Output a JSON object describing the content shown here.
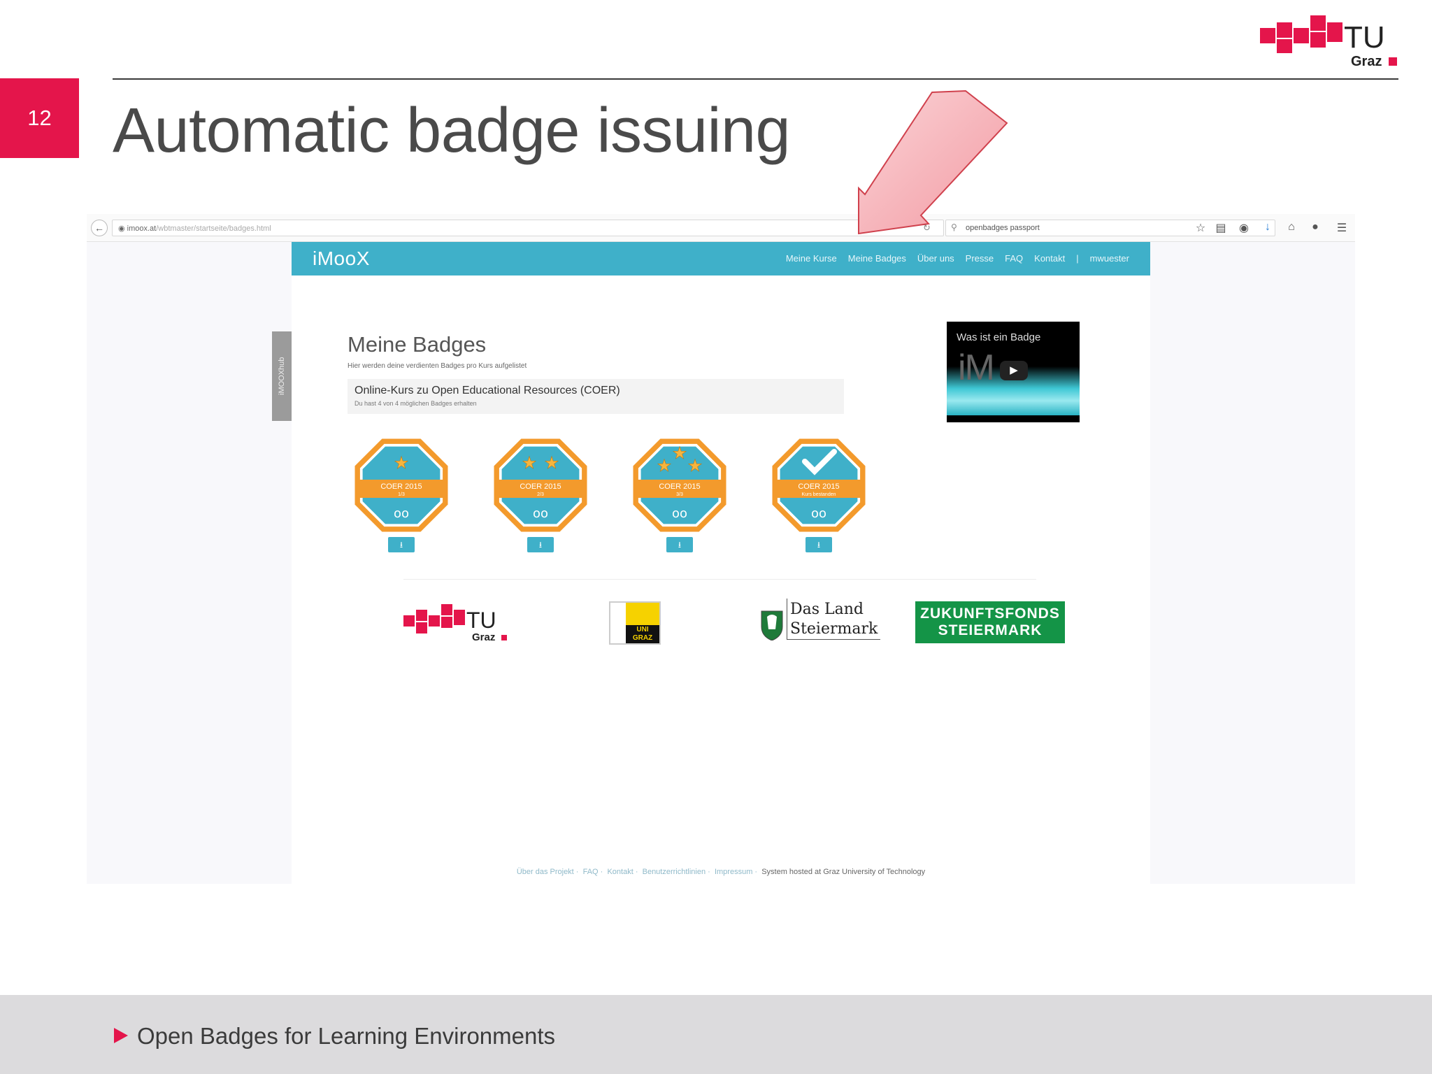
{
  "slide": {
    "number": "12",
    "title": "Automatic badge issuing",
    "footer_text": "Open Badges for Learning Environments",
    "logo_text_top": "TU",
    "logo_text_bottom": "Graz"
  },
  "browser": {
    "url_host": "imoox.at",
    "url_path": "/wbtmaster/startseite/badges.html",
    "search_text": "openbadges passport",
    "toolbar_icons": [
      "star-icon",
      "clipboard-icon",
      "pocket-icon",
      "download-icon",
      "home-icon",
      "chat-icon",
      "menu-icon"
    ]
  },
  "site": {
    "logo": "iMooX",
    "nav_items": [
      "Meine Kurse",
      "Meine Badges",
      "Über uns",
      "Presse",
      "FAQ",
      "Kontakt",
      "|",
      "mwuester"
    ],
    "side_tab": "iMOOXhub",
    "heading": "Meine Badges",
    "subtitle": "Hier werden deine verdienten Badges pro Kurs aufgelistet",
    "course_title": "Online-Kurs zu Open Educational Resources (COER)",
    "course_subtitle": "Du hast 4 von 4 möglichen Badges erhalten",
    "badges": [
      {
        "label": "COER 2015",
        "sub": "1/3",
        "stars": 1
      },
      {
        "label": "COER 2015",
        "sub": "2/3",
        "stars": 2
      },
      {
        "label": "COER 2015",
        "sub": "3/3",
        "stars": 3
      },
      {
        "label": "COER 2015",
        "sub": "Kurs bestanden",
        "stars": 0
      }
    ],
    "video_title": "Was ist ein Badge",
    "video_wordmark": "iM",
    "partner_tu_top": "TU",
    "partner_tu_bottom": "Graz",
    "partner_uni": "UNI GRAZ",
    "partner_stmk_line1": "Das Land",
    "partner_stmk_line2": "Steiermark",
    "partner_zukunft_line1": "ZUKUNFTSFONDS",
    "partner_zukunft_line2": "STEIERMARK",
    "footer_links": [
      "Über das Projekt",
      "FAQ",
      "Kontakt",
      "Benutzerrichtlinien",
      "Impressum"
    ],
    "footer_note": "System hosted at Graz University of Technology"
  },
  "colors": {
    "accent": "#e4154b",
    "site_teal": "#3fb0c9",
    "badge_orange": "#f39a2c",
    "badge_blue": "#3fb0c9"
  }
}
